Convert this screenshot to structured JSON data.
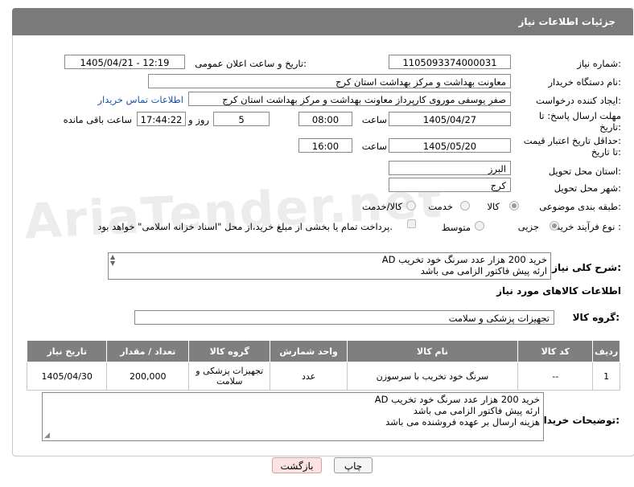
{
  "header": {
    "title": "جزئیات اطلاعات نیاز"
  },
  "form": {
    "need_number_label": "شماره نیاز:",
    "need_number": "1105093374000031",
    "announce_label": "تاریخ و ساعت اعلان عمومی:",
    "announce_value": "1405/04/21 - 12:19",
    "buyer_org_label": "نام دستگاه خریدار:",
    "buyer_org": "معاونت بهداشت و مرکز بهداشت استان کرج",
    "creator_label": "ایجاد کننده درخواست:",
    "creator": "صفر یوسفی موروی کارپرداز معاونت بهداشت و مرکز بهداشت استان کرج",
    "contact_link": "اطلاعات تماس خریدار",
    "deadline_label_1": "مهلت ارسال پاسخ: تا",
    "deadline_label_2": "تاریخ:",
    "deadline_date": "1405/04/27",
    "time_label": "ساعت",
    "deadline_time": "08:00",
    "days_value": "5",
    "days_label": "روز و",
    "remaining_time": "17:44:22",
    "remaining_label": "ساعت باقی مانده",
    "price_label_1": "حداقل تاریخ اعتبار قیمت:",
    "price_label_2": "تا تاریخ:",
    "price_date": "1405/05/20",
    "price_time": "16:00",
    "province_label": "استان محل تحویل:",
    "province": "البرز",
    "city_label": "شهر محل تحویل:",
    "city": "کرج",
    "category_label": "طبقه بندی موضوعی:",
    "category_options": [
      "کالا",
      "خدمت",
      "کالا/خدمت"
    ],
    "category_selected": "کالا",
    "process_label": "نوع فرآیند خرید :",
    "process_options": [
      "جزیی",
      "متوسط"
    ],
    "process_selected": "جزیی",
    "payment_note": "پرداخت تمام یا بخشی از مبلغ خرید،از محل \"اسناد خزانه اسلامی\" خواهد بود."
  },
  "description": {
    "label": "شرح کلی نیاز:",
    "text": "خرید 200 هزار عدد سرنگ خود تخریب AD\nارئه پیش فاکتور الزامی می باشد"
  },
  "goods": {
    "section_title": "اطلاعات کالاهای مورد نیاز",
    "group_label": "گروه کالا:",
    "group_value": "تجهیزات پزشکی و سلامت",
    "columns": [
      "ردیف",
      "کد کالا",
      "نام کالا",
      "واحد شمارش",
      "گروه کالا",
      "تعداد / مقدار",
      "تاریخ نیاز"
    ],
    "rows": [
      {
        "row": "1",
        "code": "--",
        "name": "سرنگ خود تخریب با سرسوزن",
        "unit": "عدد",
        "group": "تجهیزات پزشکی و سلامت",
        "qty": "200,000",
        "date": "1405/04/30"
      }
    ]
  },
  "buyer_notes": {
    "label": "توضیحات خریدار:",
    "text": "خرید 200 هزار عدد سرنگ خود تخریب AD\nارئه پیش فاکتور الزامی می باشد\nهزینه ارسال بر عهده فروشنده می باشد"
  },
  "buttons": {
    "print": "چاپ",
    "back": "بازگشت"
  },
  "watermark": "AriaTender.net"
}
